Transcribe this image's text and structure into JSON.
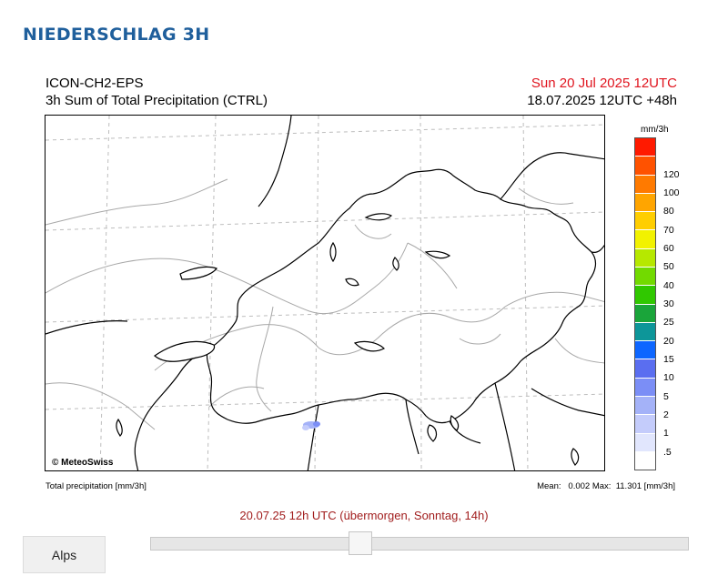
{
  "page": {
    "title": "NIEDERSCHLAG 3H"
  },
  "map": {
    "model": "ICON-CH2-EPS",
    "product": "3h Sum of Total Precipitation (CTRL)",
    "valid_time": "Sun 20 Jul 2025 12UTC",
    "run_time": "18.07.2025 12UTC +48h",
    "credit": "© MeteoSwiss",
    "footer_left": "Total precipitation [mm/3h]",
    "footer_right": "Mean:   0.002 Max:  11.301 [mm/3h]"
  },
  "legend": {
    "unit": "mm/3h",
    "levels": [
      {
        "label": "",
        "color": "#ff1a00"
      },
      {
        "label": "120",
        "color": "#ff5200"
      },
      {
        "label": "100",
        "color": "#ff7a00"
      },
      {
        "label": "80",
        "color": "#ffa500"
      },
      {
        "label": "70",
        "color": "#ffce00"
      },
      {
        "label": "60",
        "color": "#f2f200"
      },
      {
        "label": "50",
        "color": "#b6e800"
      },
      {
        "label": "40",
        "color": "#72da00"
      },
      {
        "label": "30",
        "color": "#30c800"
      },
      {
        "label": "25",
        "color": "#1aa53a"
      },
      {
        "label": "20",
        "color": "#0d9699"
      },
      {
        "label": "15",
        "color": "#0d66ff"
      },
      {
        "label": "10",
        "color": "#5a6ef0"
      },
      {
        "label": "5",
        "color": "#7b8ef6"
      },
      {
        "label": "2",
        "color": "#a4b2f8"
      },
      {
        "label": "1",
        "color": "#c4ccfb"
      },
      {
        "label": ".5",
        "color": "#e1e6fd"
      },
      {
        "label": "",
        "color": "#ffffff"
      }
    ]
  },
  "timeline": {
    "label": "20.07.25 12h UTC (übermorgen, Sonntag, 14h)",
    "position": 0.39
  },
  "region_button": {
    "label": "Alps"
  }
}
